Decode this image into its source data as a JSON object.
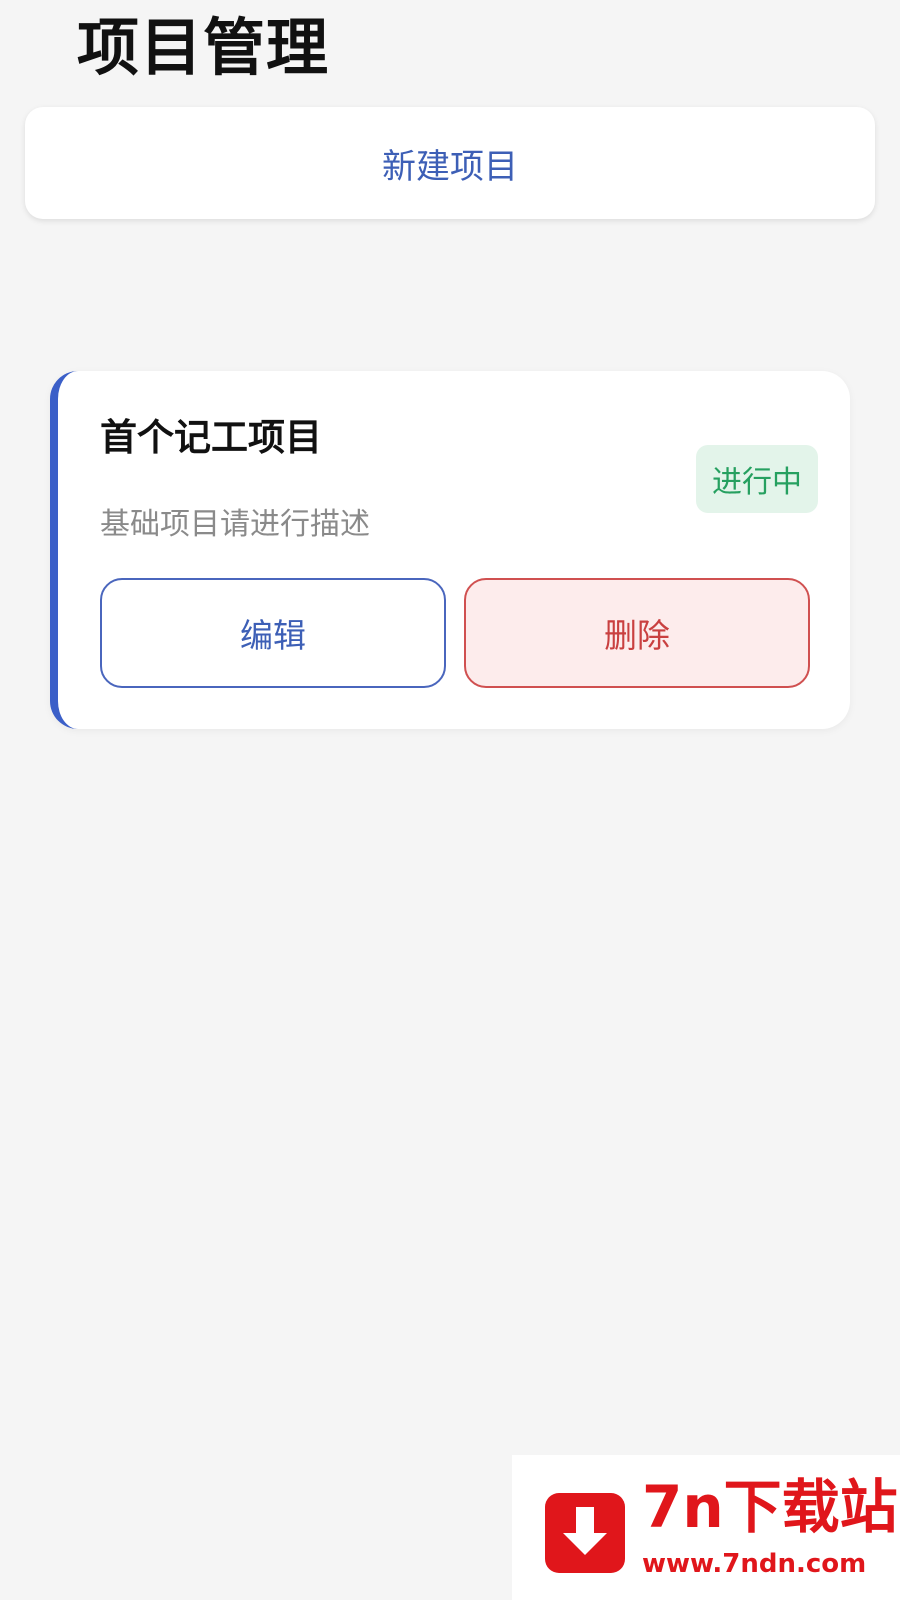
{
  "header": {
    "title": "项目管理"
  },
  "actions": {
    "new_project_label": "新建项目"
  },
  "project": {
    "name": "首个记工项目",
    "status": "进行中",
    "description": "基础项目请进行描述",
    "edit_label": "编辑",
    "delete_label": "删除"
  },
  "watermark": {
    "name": "7n下载站",
    "url": "www.7ndn.com",
    "icon": "download-arrow-icon"
  },
  "colors": {
    "accent": "#3b5fc8",
    "status_green": "#26a060",
    "danger": "#d05050",
    "watermark_red": "#e0161b"
  }
}
